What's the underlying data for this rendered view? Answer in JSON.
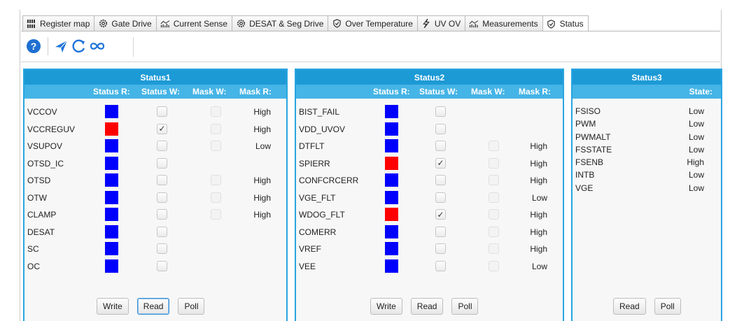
{
  "tabs": [
    {
      "label": "Register map",
      "icon": "register-map-icon"
    },
    {
      "label": "Gate Drive",
      "icon": "gear-icon"
    },
    {
      "label": "Current Sense",
      "icon": "chart-bars-icon"
    },
    {
      "label": "DESAT & Seg Drive",
      "icon": "gear-icon"
    },
    {
      "label": "Over Temperature",
      "icon": "shield-check-icon"
    },
    {
      "label": "UV OV",
      "icon": "lightning-icon"
    },
    {
      "label": "Measurements",
      "icon": "chart-bars-icon"
    },
    {
      "label": "Status",
      "icon": "shield-check-icon",
      "active": true
    }
  ],
  "toolbar": [
    "help-icon",
    "send-icon",
    "refresh-icon",
    "infinity-loop-icon"
  ],
  "colors": {
    "accent": "#1c9ad6",
    "header": "#45b4e6",
    "led_on": "#ff0000",
    "led_off": "#0000ff"
  },
  "status1": {
    "title": "Status1",
    "headers": {
      "status_r": "Status R:",
      "status_w": "Status W:",
      "mask_w": "Mask W:",
      "mask_r": "Mask R:"
    },
    "rows": [
      {
        "name": "VCCOV",
        "led": "off",
        "status_w": false,
        "mask_w": false,
        "mask_r": "High"
      },
      {
        "name": "VCCREGUV",
        "led": "on",
        "status_w": true,
        "mask_w": false,
        "mask_r": "High"
      },
      {
        "name": "VSUPOV",
        "led": "off",
        "status_w": false,
        "mask_w": false,
        "mask_r": "Low"
      },
      {
        "name": "OTSD_IC",
        "led": "off",
        "status_w": false,
        "mask_w": null,
        "mask_r": ""
      },
      {
        "name": "OTSD",
        "led": "off",
        "status_w": false,
        "mask_w": false,
        "mask_r": "High"
      },
      {
        "name": "OTW",
        "led": "off",
        "status_w": false,
        "mask_w": false,
        "mask_r": "High"
      },
      {
        "name": "CLAMP",
        "led": "off",
        "status_w": false,
        "mask_w": false,
        "mask_r": "High"
      },
      {
        "name": "DESAT",
        "led": "off",
        "status_w": false,
        "mask_w": null,
        "mask_r": ""
      },
      {
        "name": "SC",
        "led": "off",
        "status_w": false,
        "mask_w": null,
        "mask_r": ""
      },
      {
        "name": "OC",
        "led": "off",
        "status_w": false,
        "mask_w": null,
        "mask_r": ""
      }
    ],
    "buttons": {
      "write": "Write",
      "read": "Read",
      "poll": "Poll"
    }
  },
  "status2": {
    "title": "Status2",
    "headers": {
      "status_r": "Status R:",
      "status_w": "Status W:",
      "mask_w": "Mask W:",
      "mask_r": "Mask R:"
    },
    "rows": [
      {
        "name": "BIST_FAIL",
        "led": "off",
        "status_w": false,
        "mask_w": null,
        "mask_r": ""
      },
      {
        "name": "VDD_UVOV",
        "led": "off",
        "status_w": false,
        "mask_w": null,
        "mask_r": ""
      },
      {
        "name": "DTFLT",
        "led": "off",
        "status_w": false,
        "mask_w": false,
        "mask_r": "High"
      },
      {
        "name": "SPIERR",
        "led": "on",
        "status_w": true,
        "mask_w": false,
        "mask_r": "High"
      },
      {
        "name": "CONFCRCERR",
        "led": "off",
        "status_w": false,
        "mask_w": false,
        "mask_r": "High"
      },
      {
        "name": "VGE_FLT",
        "led": "off",
        "status_w": false,
        "mask_w": false,
        "mask_r": "Low"
      },
      {
        "name": "WDOG_FLT",
        "led": "on",
        "status_w": true,
        "mask_w": false,
        "mask_r": "High"
      },
      {
        "name": "COMERR",
        "led": "off",
        "status_w": false,
        "mask_w": false,
        "mask_r": "High"
      },
      {
        "name": "VREF",
        "led": "off",
        "status_w": false,
        "mask_w": false,
        "mask_r": "High"
      },
      {
        "name": "VEE",
        "led": "off",
        "status_w": false,
        "mask_w": false,
        "mask_r": "Low"
      }
    ],
    "buttons": {
      "write": "Write",
      "read": "Read",
      "poll": "Poll"
    }
  },
  "status3": {
    "title": "Status3",
    "header": "State:",
    "rows": [
      {
        "name": "FSISO",
        "value": "Low"
      },
      {
        "name": "PWM",
        "value": "Low"
      },
      {
        "name": "PWMALT",
        "value": "Low"
      },
      {
        "name": "FSSTATE",
        "value": "Low"
      },
      {
        "name": "FSENB",
        "value": "High"
      },
      {
        "name": "INTB",
        "value": "Low"
      },
      {
        "name": "VGE",
        "value": "Low"
      }
    ],
    "buttons": {
      "read": "Read",
      "poll": "Poll"
    }
  }
}
